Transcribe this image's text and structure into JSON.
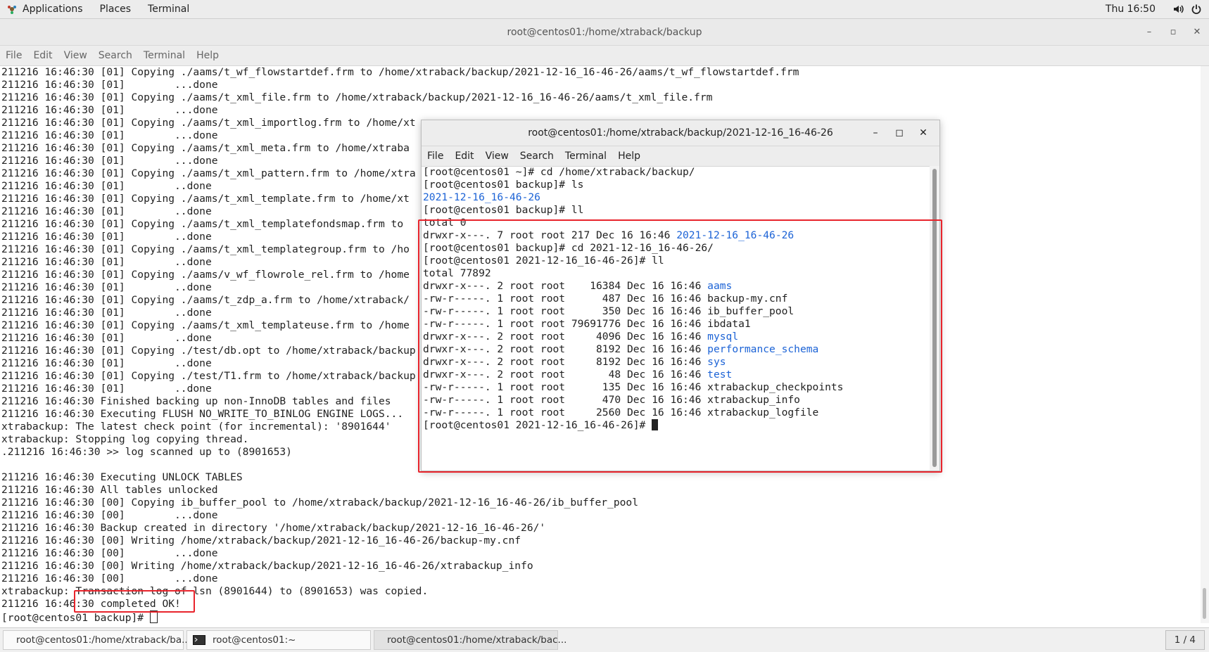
{
  "topbar": {
    "menus": [
      "Applications",
      "Places",
      "Terminal"
    ],
    "clock": "Thu 16:50"
  },
  "main_window": {
    "title": "root@centos01:/home/xtraback/backup",
    "menu": [
      "File",
      "Edit",
      "View",
      "Search",
      "Terminal",
      "Help"
    ],
    "lines": [
      "211216 16:46:30 [01] Copying ./aams/t_wf_flowstartdef.frm to /home/xtraback/backup/2021-12-16_16-46-26/aams/t_wf_flowstartdef.frm",
      "211216 16:46:30 [01]        ...done",
      "211216 16:46:30 [01] Copying ./aams/t_xml_file.frm to /home/xtraback/backup/2021-12-16_16-46-26/aams/t_xml_file.frm",
      "211216 16:46:30 [01]        ...done",
      "211216 16:46:30 [01] Copying ./aams/t_xml_importlog.frm to /home/xt",
      "211216 16:46:30 [01]        ...done",
      "211216 16:46:30 [01] Copying ./aams/t_xml_meta.frm to /home/xtraba",
      "211216 16:46:30 [01]        ...done",
      "211216 16:46:30 [01] Copying ./aams/t_xml_pattern.frm to /home/xtra",
      "211216 16:46:30 [01]        ..done",
      "211216 16:46:30 [01] Copying ./aams/t_xml_template.frm to /home/xt",
      "211216 16:46:30 [01]        ..done",
      "211216 16:46:30 [01] Copying ./aams/t_xml_templatefondsmap.frm to",
      "211216 16:46:30 [01]        ..done",
      "211216 16:46:30 [01] Copying ./aams/t_xml_templategroup.frm to /ho",
      "211216 16:46:30 [01]        ..done",
      "211216 16:46:30 [01] Copying ./aams/v_wf_flowrole_rel.frm to /home",
      "211216 16:46:30 [01]        ..done",
      "211216 16:46:30 [01] Copying ./aams/t_zdp_a.frm to /home/xtraback/",
      "211216 16:46:30 [01]        ..done",
      "211216 16:46:30 [01] Copying ./aams/t_xml_templateuse.frm to /home",
      "211216 16:46:30 [01]        ..done",
      "211216 16:46:30 [01] Copying ./test/db.opt to /home/xtraback/backup",
      "211216 16:46:30 [01]        ..done",
      "211216 16:46:30 [01] Copying ./test/T1.frm to /home/xtraback/backup",
      "211216 16:46:30 [01]        ..done",
      "211216 16:46:30 Finished backing up non-InnoDB tables and files",
      "211216 16:46:30 Executing FLUSH NO_WRITE_TO_BINLOG ENGINE LOGS...",
      "xtrabackup: The latest check point (for incremental): '8901644'",
      "xtrabackup: Stopping log copying thread.",
      ".211216 16:46:30 >> log scanned up to (8901653)",
      "",
      "211216 16:46:30 Executing UNLOCK TABLES",
      "211216 16:46:30 All tables unlocked",
      "211216 16:46:30 [00] Copying ib_buffer_pool to /home/xtraback/backup/2021-12-16_16-46-26/ib_buffer_pool",
      "211216 16:46:30 [00]        ...done",
      "211216 16:46:30 Backup created in directory '/home/xtraback/backup/2021-12-16_16-46-26/'",
      "211216 16:46:30 [00] Writing /home/xtraback/backup/2021-12-16_16-46-26/backup-my.cnf",
      "211216 16:46:30 [00]        ...done",
      "211216 16:46:30 [00] Writing /home/xtraback/backup/2021-12-16_16-46-26/xtrabackup_info",
      "211216 16:46:30 [00]        ...done",
      "xtrabackup: Transaction log of lsn (8901644) to (8901653) was copied.",
      "211216 16:46:30 completed OK!"
    ],
    "prompt": "[root@centos01 backup]# "
  },
  "inner_window": {
    "title": "root@centos01:/home/xtraback/backup/2021-12-16_16-46-26",
    "menu": [
      "File",
      "Edit",
      "View",
      "Search",
      "Terminal",
      "Help"
    ],
    "lines": [
      {
        "t": "[root@centos01 ~]# cd /home/xtraback/backup/"
      },
      {
        "t": "[root@centos01 backup]# ls"
      },
      {
        "t": "",
        "b": "2021-12-16_16-46-26"
      },
      {
        "t": "[root@centos01 backup]# ll"
      },
      {
        "t": "total 0"
      },
      {
        "t": "drwxr-x---. 7 root root 217 Dec 16 16:46 ",
        "b": "2021-12-16_16-46-26"
      },
      {
        "t": "[root@centos01 backup]# cd 2021-12-16_16-46-26/"
      },
      {
        "t": "[root@centos01 2021-12-16_16-46-26]# ll"
      },
      {
        "t": "total 77892"
      },
      {
        "t": "drwxr-x---. 2 root root    16384 Dec 16 16:46 ",
        "b": "aams"
      },
      {
        "t": "-rw-r-----. 1 root root      487 Dec 16 16:46 backup-my.cnf"
      },
      {
        "t": "-rw-r-----. 1 root root      350 Dec 16 16:46 ib_buffer_pool"
      },
      {
        "t": "-rw-r-----. 1 root root 79691776 Dec 16 16:46 ibdata1"
      },
      {
        "t": "drwxr-x---. 2 root root     4096 Dec 16 16:46 ",
        "b": "mysql"
      },
      {
        "t": "drwxr-x---. 2 root root     8192 Dec 16 16:46 ",
        "b": "performance_schema"
      },
      {
        "t": "drwxr-x---. 2 root root     8192 Dec 16 16:46 ",
        "b": "sys"
      },
      {
        "t": "drwxr-x---. 2 root root       48 Dec 16 16:46 ",
        "b": "test"
      },
      {
        "t": "-rw-r-----. 1 root root      135 Dec 16 16:46 xtrabackup_checkpoints"
      },
      {
        "t": "-rw-r-----. 1 root root      470 Dec 16 16:46 xtrabackup_info"
      },
      {
        "t": "-rw-r-----. 1 root root     2560 Dec 16 16:46 xtrabackup_logfile"
      }
    ],
    "prompt": "[root@centos01 2021-12-16_16-46-26]# "
  },
  "taskbar": {
    "items": [
      "root@centos01:/home/xtraback/ba...",
      "root@centos01:~",
      "root@centos01:/home/xtraback/bac..."
    ],
    "pager": "1 / 4"
  },
  "colors": {
    "link_blue": "#1c63d6",
    "highlight_red": "#e8242c"
  },
  "icons": [
    "applications-icon",
    "volume-icon",
    "power-icon",
    "terminal-icon"
  ]
}
